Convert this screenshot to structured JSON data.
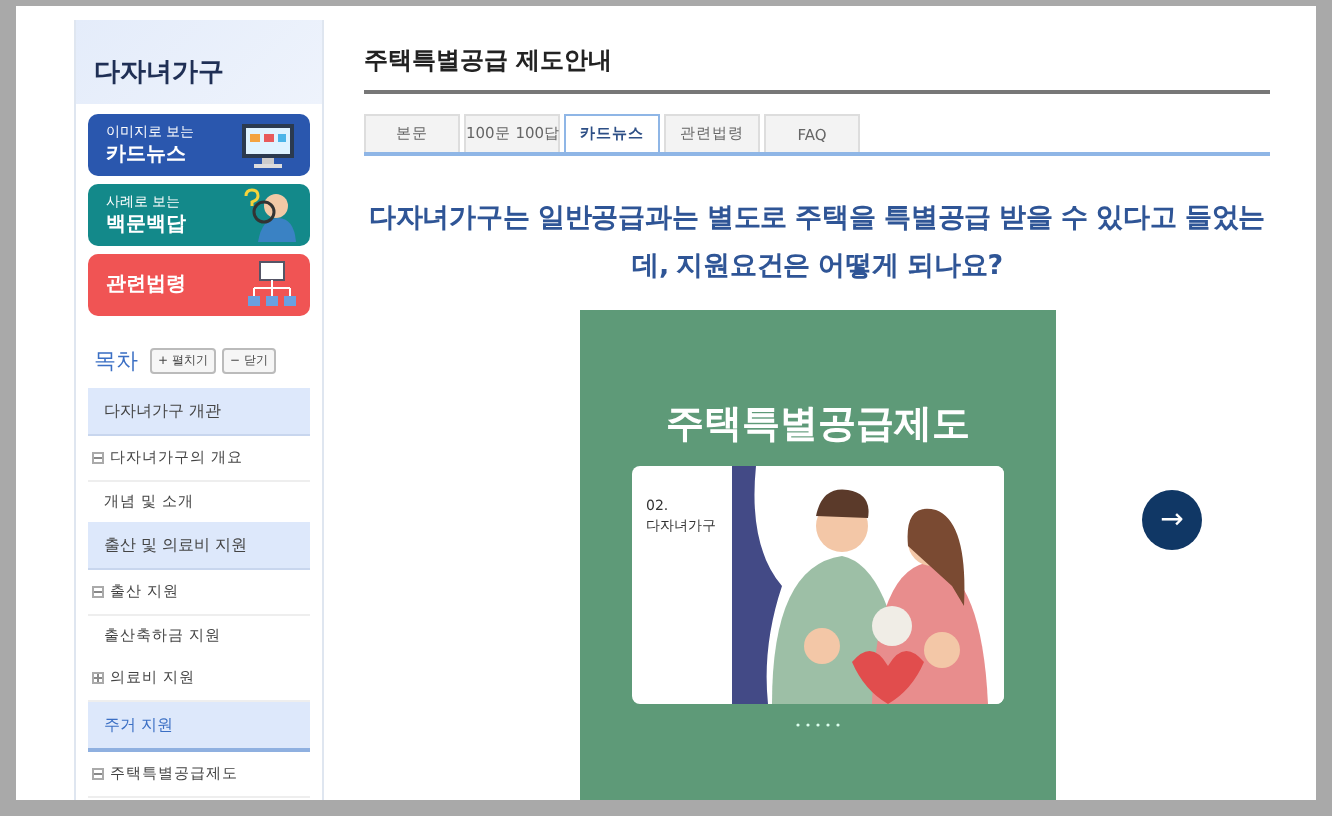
{
  "sidebar": {
    "title": "다자녀가구",
    "banners": [
      {
        "kind": "cardnews",
        "small": "이미지로 보는",
        "big": "카드뉴스"
      },
      {
        "kind": "qa",
        "small": "사례로 보는",
        "big": "백문백답"
      },
      {
        "kind": "law",
        "big": "관련법령"
      }
    ],
    "toc": {
      "label": "목차",
      "buttons": [
        "+ 펼치기",
        "− 닫기"
      ]
    },
    "sections": [
      {
        "label": "다자녀가구 개관",
        "selected": false,
        "children": [
          {
            "label": "다자녀가구의 개요",
            "expanded": true,
            "children": [
              {
                "label": "개념 및 소개"
              }
            ]
          }
        ]
      },
      {
        "label": "출산 및 의료비 지원",
        "selected": false,
        "children": [
          {
            "label": "출산 지원",
            "expanded": true,
            "children": [
              {
                "label": "출산축하금 지원"
              }
            ]
          },
          {
            "label": "의료비 지원",
            "expanded": false
          }
        ]
      },
      {
        "label": "주거 지원",
        "selected": true,
        "children": [
          {
            "label": "주택특별공급제도",
            "expanded": true
          }
        ]
      }
    ]
  },
  "main": {
    "title": "주택특별공급 제도안내",
    "tabs": [
      {
        "label": "본문",
        "selected": false
      },
      {
        "label": "100문 100답",
        "selected": false
      },
      {
        "label": "카드뉴스",
        "selected": true
      },
      {
        "label": "관련법령",
        "selected": false
      },
      {
        "label": "FAQ",
        "selected": false
      }
    ],
    "question": "다자녀가구는 일반공급과는 별도로 주택을 특별공급 받을 수 있다고 들었는데, 지원요건은 어떻게 되나요?",
    "card": {
      "title": "주택특별공급제도",
      "number": "02.",
      "subtitle": "다자녀가구",
      "next": "→"
    }
  }
}
